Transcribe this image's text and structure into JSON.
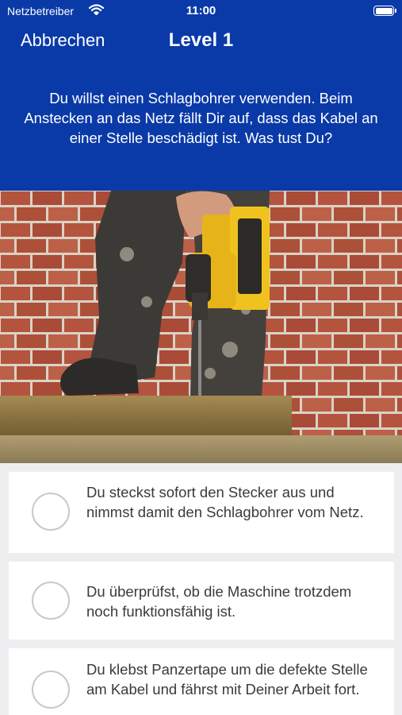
{
  "status_bar": {
    "carrier": "Netzbetreiber",
    "time": "11:00",
    "wifi_icon": "wifi-icon",
    "battery_icon": "battery-full-icon"
  },
  "nav": {
    "cancel_label": "Abbrechen",
    "title": "Level 1"
  },
  "question": {
    "text": "Du willst einen Schlagbohrer verwenden. Beim Anstecken an das Netz fällt Dir auf, dass das Kabel an einer Stelle beschädigt ist. Was tust Du?"
  },
  "answers": [
    {
      "text": "Du steckst sofort den Stecker aus und nimmst damit den Schlagbohrer vom Netz."
    },
    {
      "text": "Du überprüfst, ob die Maschine trotzdem noch funktionsfähig ist."
    },
    {
      "text": "Du klebst Panzertape um die defekte Stelle am Kabel und fährst mit Deiner Arbeit fort."
    }
  ],
  "colors": {
    "header_blue": "#0a3aa8",
    "background": "#eeeef0",
    "card": "#ffffff",
    "answer_text": "#3a3a3c"
  }
}
